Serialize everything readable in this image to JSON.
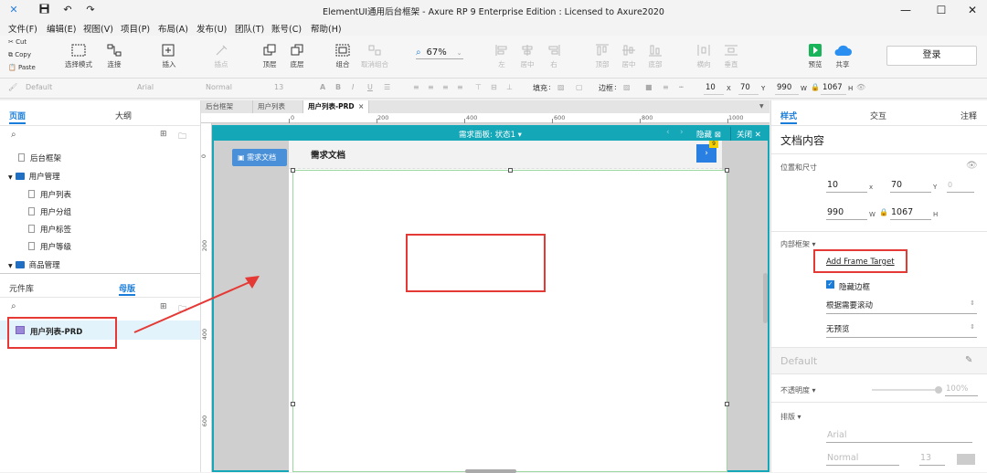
{
  "window": {
    "title": "ElementUI通用后台框架 - Axure RP 9 Enterprise Edition : Licensed to Axure2020",
    "icon": "axure-logo-icon",
    "controls": [
      "minimize-icon",
      "maximize-icon",
      "close-icon"
    ]
  },
  "menu": [
    "文件(F)",
    "编辑(E)",
    "视图(V)",
    "项目(P)",
    "布局(A)",
    "发布(U)",
    "团队(T)",
    "账号(C)",
    "帮助(H)"
  ],
  "toolbar": {
    "clipboard": [
      "Cut",
      "Copy",
      "Paste"
    ],
    "select_mode": "选择模式",
    "connect": "连接",
    "insert": "插入",
    "point": "插点",
    "top": "顶层",
    "bottom": "底层",
    "group": "组合",
    "ungroup": "取消组合",
    "zoom": "67%",
    "align": [
      "左",
      "居中",
      "右",
      "顶部",
      "居中",
      "底部"
    ],
    "distribute": [
      "横向",
      "垂直"
    ],
    "preview": "预览",
    "share": "共享",
    "login": "登录"
  },
  "format": {
    "style": "Default",
    "font": "Arial",
    "weight": "Normal",
    "size": "13",
    "fill_label": "填充",
    "border_label": "边框",
    "x": "10",
    "y": "70",
    "w": "990",
    "h": "1067",
    "x_label": "X",
    "y_label": "Y",
    "w_label": "W",
    "h_label": "H"
  },
  "pages_panel": {
    "tabs": [
      "页面",
      "大纲"
    ],
    "items": [
      {
        "label": "后台框架",
        "type": "page",
        "indent": 0
      },
      {
        "label": "用户管理",
        "type": "folder",
        "indent": 0
      },
      {
        "label": "用户列表",
        "type": "page",
        "indent": 1
      },
      {
        "label": "用户分组",
        "type": "page",
        "indent": 1
      },
      {
        "label": "用户标签",
        "type": "page",
        "indent": 1
      },
      {
        "label": "用户等级",
        "type": "page",
        "indent": 1
      },
      {
        "label": "商品管理",
        "type": "folder",
        "indent": 0
      }
    ]
  },
  "masters_panel": {
    "tabs": [
      "元件库",
      "母版"
    ],
    "selected_item": "用户列表-PRD"
  },
  "doc_tabs": [
    "后台框架",
    "用户列表",
    "用户列表-PRD"
  ],
  "ruler": {
    "horizontal": [
      "0",
      "200",
      "400",
      "600",
      "800",
      "1000"
    ],
    "vertical": [
      "0",
      "200",
      "400",
      "600"
    ]
  },
  "dynamic_panel": {
    "title": "需求面板: 状态1",
    "hide_label": "隐藏",
    "close_label": "关闭",
    "button_label": "需求文档",
    "header_title": "需求文档",
    "badge": "9"
  },
  "right_panel": {
    "tabs": [
      "样式",
      "交互",
      "注释"
    ],
    "heading": "文档内容",
    "position_label": "位置和尺寸",
    "x": "10",
    "y": "70",
    "rotation": "0",
    "w": "990",
    "h": "1067",
    "x_unit": "x",
    "y_unit": "Y",
    "w_unit": "W",
    "h_unit": "H",
    "frame_label": "内部框架",
    "frame_target": "Add Frame Target",
    "hide_border": "隐藏边框",
    "scroll_option": "根据需要滚动",
    "preview_option": "无预览",
    "default_style": "Default",
    "opacity_label": "不透明度",
    "opacity_value": "100%",
    "typography_label": "排版",
    "font": "Arial",
    "font_weight": "Normal",
    "font_size": "13"
  },
  "colors": {
    "accent": "#1a7dd9",
    "panel_teal": "#13a7b8",
    "highlight_red": "#e53935",
    "folder_blue": "#1f6fc5"
  }
}
